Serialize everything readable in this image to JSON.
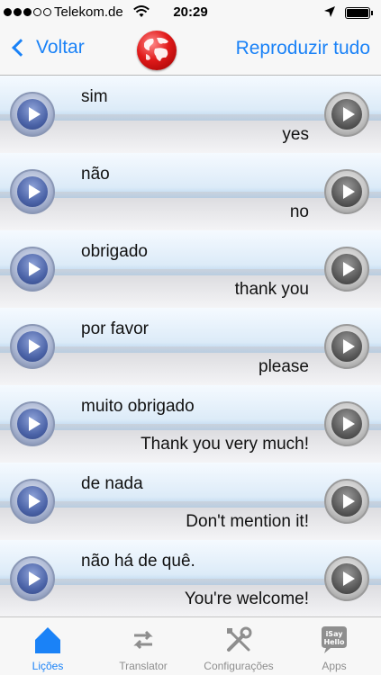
{
  "status": {
    "carrier": "Telekom.de",
    "time": "20:29"
  },
  "nav": {
    "back_label": "Voltar",
    "play_all_label": "Reproduzir tudo"
  },
  "rows": [
    {
      "source": "sim",
      "target": "yes"
    },
    {
      "source": "não",
      "target": "no"
    },
    {
      "source": "obrigado",
      "target": "thank you"
    },
    {
      "source": "por favor",
      "target": "please"
    },
    {
      "source": "muito obrigado",
      "target": "Thank you very much!"
    },
    {
      "source": "de nada",
      "target": "Don't mention it!"
    },
    {
      "source": "não há de quê.",
      "target": "You're welcome!"
    }
  ],
  "tabs": [
    {
      "label": "Lições",
      "icon": "home-icon",
      "active": true
    },
    {
      "label": "Translator",
      "icon": "swap-arrows-icon",
      "active": false
    },
    {
      "label": "Configurações",
      "icon": "tools-icon",
      "active": false
    },
    {
      "label": "Apps",
      "icon": "isayhello-apps-icon",
      "active": false
    }
  ],
  "logo_text": {
    "apps_icon": "iSay Hello"
  },
  "colors": {
    "accent": "#1a82f7",
    "inactive": "#8e8e8e"
  }
}
